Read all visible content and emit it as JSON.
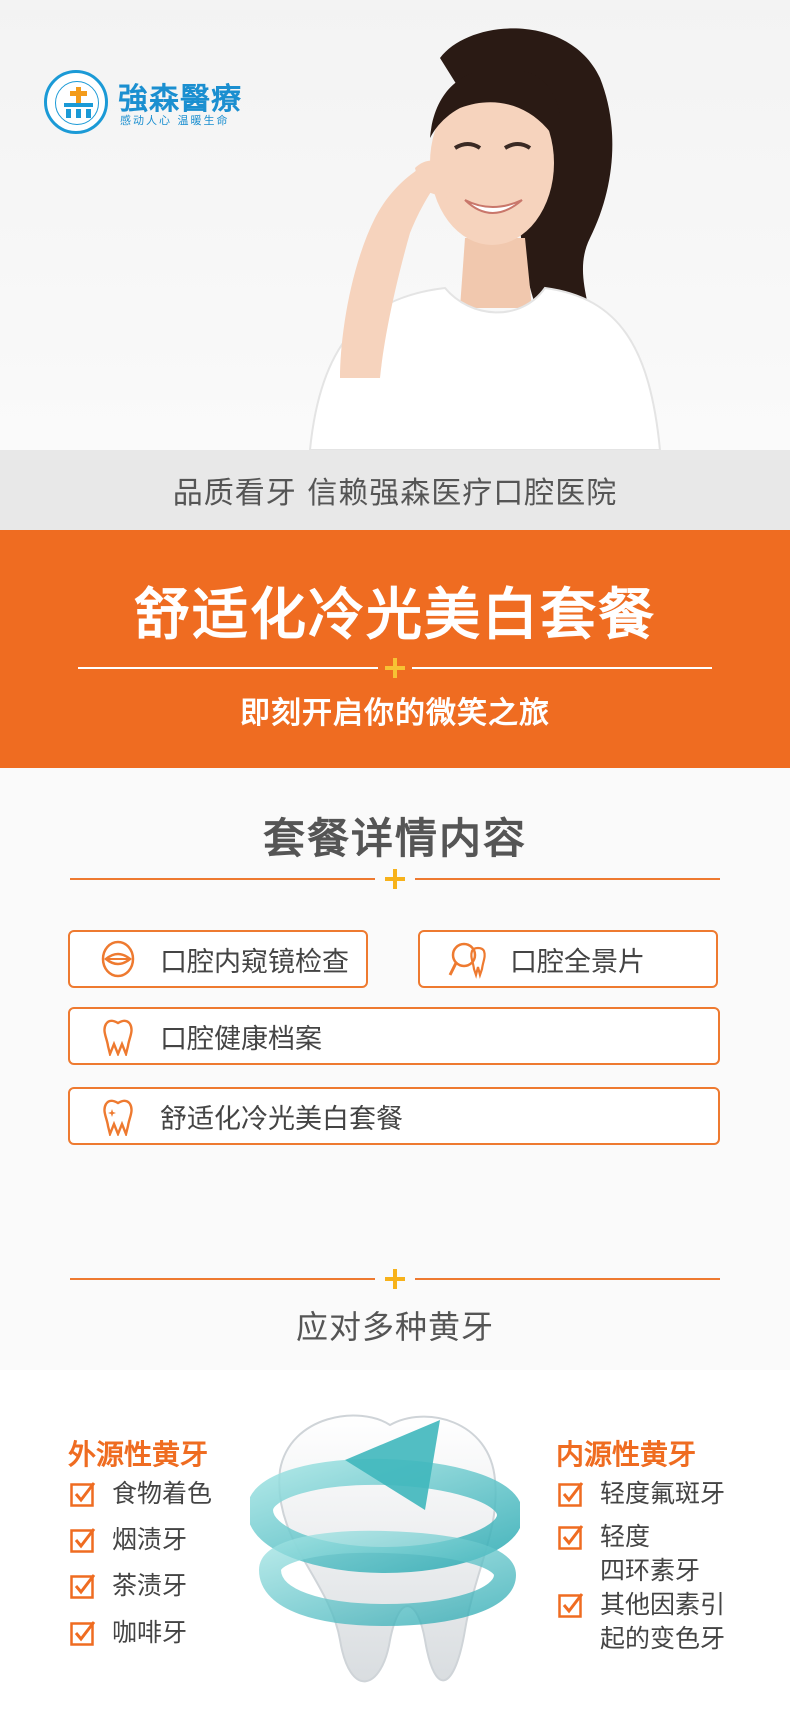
{
  "brand": {
    "name": "強森醫療",
    "slogan": "感动人心  温暖生命",
    "colors": {
      "primary_blue": "#1b8fd0",
      "accent_orange": "#ef6c21",
      "plus_yellow": "#f7b21b"
    }
  },
  "tagline": "品质看牙  信赖强森医疗口腔医院",
  "banner": {
    "title": "舒适化冷光美白套餐",
    "subtitle": "即刻开启你的微笑之旅"
  },
  "package": {
    "title": "套餐详情内容",
    "items": [
      {
        "label": "口腔内窥镜检查",
        "icon": "mouth-icon"
      },
      {
        "label": "口腔全景片",
        "icon": "xray-tooth-icon"
      },
      {
        "label": "口腔健康档案",
        "icon": "tooth-icon"
      },
      {
        "label": "舒适化冷光美白套餐",
        "icon": "sparkle-tooth-icon"
      }
    ]
  },
  "yellow_teeth": {
    "title": "应对多种黄牙",
    "external": {
      "title": "外源性黄牙",
      "items": [
        "食物着色",
        "烟渍牙",
        "茶渍牙",
        "咖啡牙"
      ]
    },
    "internal": {
      "title": "内源性黄牙",
      "items": [
        "轻度氟斑牙",
        "轻度\n四环素牙",
        "其他因素引\n起的变色牙"
      ]
    }
  }
}
